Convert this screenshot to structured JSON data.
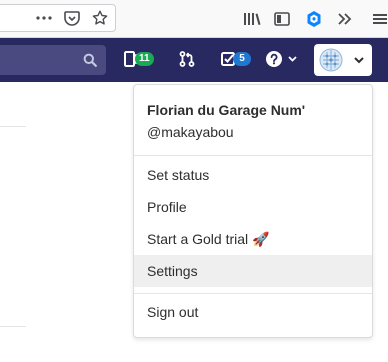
{
  "navbar": {
    "issues_count": "11",
    "todos_count": "5",
    "issues_badge_color": "#1aaa55",
    "todos_badge_color": "#1f78d1",
    "bg_color": "#292961"
  },
  "user_menu": {
    "name": "Florian du Garage Num'",
    "username": "@makayabou",
    "items": [
      {
        "label": "Set status"
      },
      {
        "label": "Profile"
      },
      {
        "label": "Start a Gold trial 🚀"
      },
      {
        "label": "Settings"
      },
      {
        "label": "Sign out"
      }
    ],
    "highlighted_item": "Settings"
  }
}
